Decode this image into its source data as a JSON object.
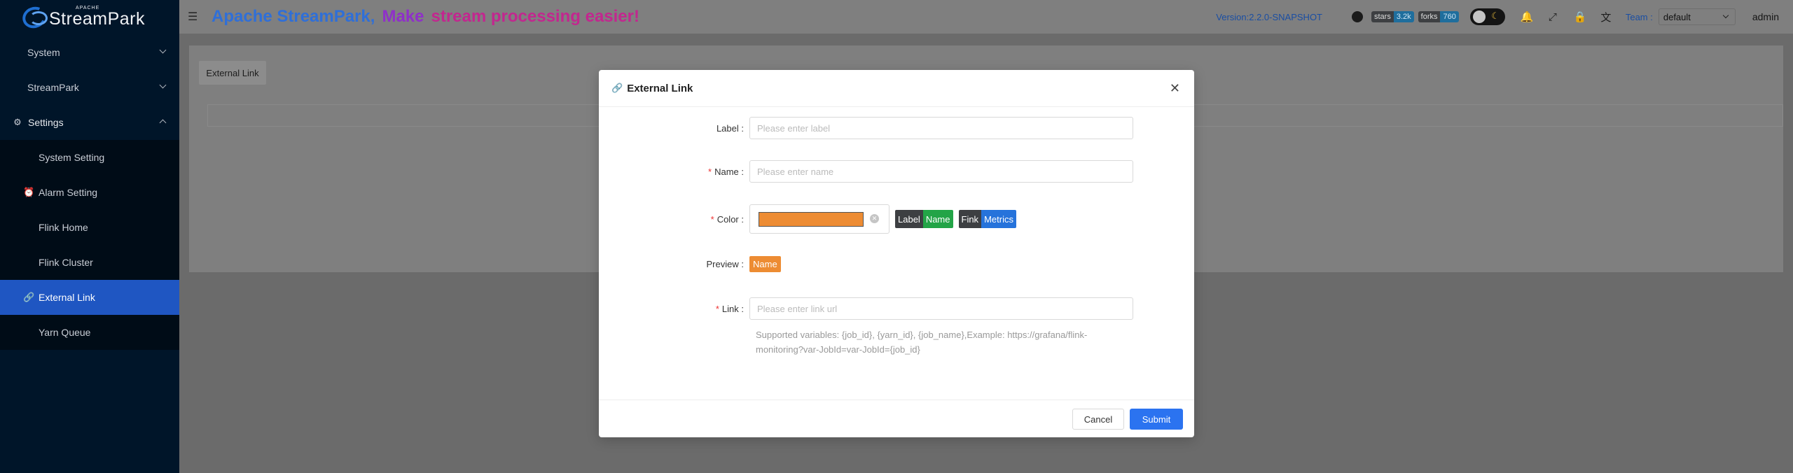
{
  "app": {
    "logo_small": "APACHE",
    "logo_big": "StreamPark"
  },
  "sidebar": {
    "items": [
      {
        "label": "System",
        "expanded": false
      },
      {
        "label": "StreamPark",
        "expanded": false
      },
      {
        "label": "Settings",
        "expanded": true,
        "icon": "gear-icon"
      },
      {
        "label": "System Setting"
      },
      {
        "label": "Alarm Setting",
        "icon": "alarm-icon"
      },
      {
        "label": "Flink Home"
      },
      {
        "label": "Flink Cluster"
      },
      {
        "label": "External Link",
        "icon": "link-icon",
        "active": true
      },
      {
        "label": "Yarn Queue"
      }
    ]
  },
  "header": {
    "slogan_1": "Apache StreamPark,",
    "slogan_2": "Make",
    "slogan_3": "stream processing easier!",
    "version": "Version:2.2.0-SNAPSHOT",
    "stars_key": "stars",
    "stars_val": "3.2k",
    "forks_key": "forks",
    "forks_val": "760",
    "team_label": "Team :",
    "team_value": "default",
    "user": "admin"
  },
  "content": {
    "external_link_button": "External Link"
  },
  "modal": {
    "title": "External Link",
    "label_label": "Label",
    "label_placeholder": "Please enter label",
    "name_label": "Name",
    "name_placeholder": "Please enter name",
    "color_label": "Color",
    "color_value": "#ed8c33",
    "tag1_a": "Label",
    "tag1_b": "Name",
    "tag2_a": "Fink",
    "tag2_b": "Metrics",
    "preview_label": "Preview",
    "preview_value": "Name",
    "link_label": "Link",
    "link_placeholder": "Please enter link url",
    "help_line1": "Supported variables: {job_id}, {yarn_id}, {job_name},Example: https://grafana/flink-",
    "help_line2": "monitoring?var-JobId=var-JobId={job_id}",
    "cancel": "Cancel",
    "submit": "Submit"
  },
  "colors": {
    "sidebar_bg": "#001529",
    "active_bg": "#1f56c2",
    "primary": "#2b73f0",
    "orange": "#ed8c33"
  }
}
